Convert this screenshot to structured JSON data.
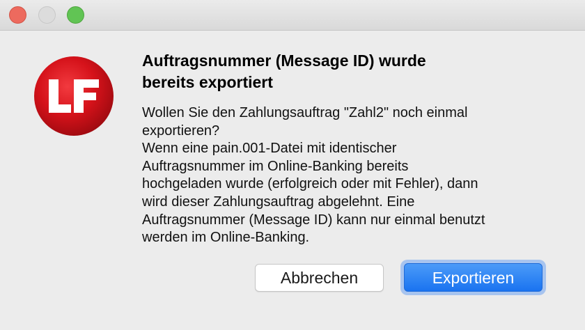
{
  "dialog": {
    "headline": [
      "Auftragsnummer (Message ID) wurde",
      "bereits exportiert"
    ],
    "message": [
      "Wollen Sie den Zahlungsauftrag \"Zahl2\" noch einmal",
      "exportieren?",
      "Wenn eine pain.001-Datei mit identischer",
      "Auftragsnummer im Online-Banking bereits",
      "hochgeladen wurde (erfolgreich oder mit Fehler), dann",
      "wird dieser Zahlungsauftrag abgelehnt. Eine",
      "Auftragsnummer (Message ID) kann nur einmal benutzt",
      "werden im Online-Banking."
    ],
    "cancel_label": "Abbrechen",
    "export_label": "Exportieren"
  },
  "logo": {
    "text": "LF",
    "icon": "lf-app-logo",
    "color": "#d8131b"
  },
  "window_controls": {
    "close_color": "#ed6a5e",
    "minimize_color": "#dcdcdc",
    "zoom_color": "#61c454"
  },
  "accent_color": "#1a73f0"
}
